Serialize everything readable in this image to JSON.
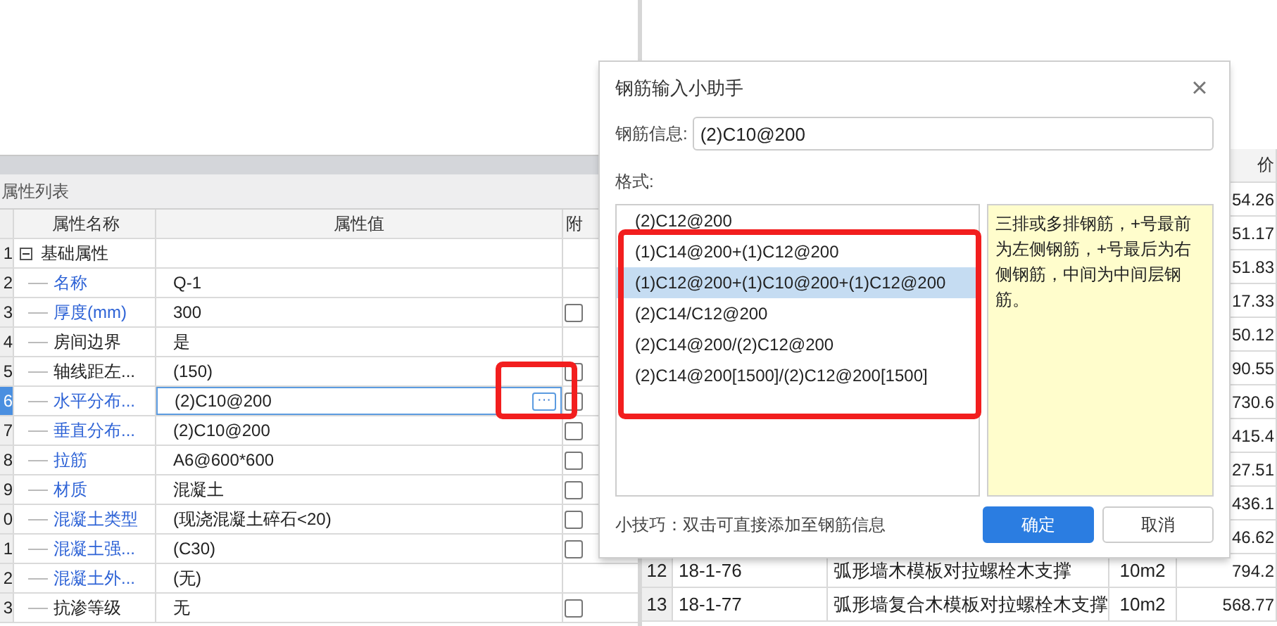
{
  "property_panel": {
    "title": "属性列表",
    "columns": [
      "属性名称",
      "属性值",
      "附"
    ],
    "rows": [
      {
        "number": "1",
        "kind": "group",
        "name": "基础属性",
        "expanded": true,
        "value": "",
        "checkbox": false,
        "selected": false
      },
      {
        "number": "2",
        "kind": "field",
        "name": "名称",
        "value": "Q-1",
        "checkbox": false,
        "linked": true,
        "selected": false
      },
      {
        "number": "3",
        "kind": "field",
        "name": "厚度(mm)",
        "value": "300",
        "checkbox": true,
        "linked": true,
        "selected": false
      },
      {
        "number": "4",
        "kind": "field",
        "name": "房间边界",
        "value": "是",
        "checkbox": false,
        "linked": false,
        "selected": false
      },
      {
        "number": "5",
        "kind": "field",
        "name": "轴线距左...",
        "value": "(150)",
        "checkbox": true,
        "linked": false,
        "selected": false
      },
      {
        "number": "6",
        "kind": "field",
        "name": "水平分布...",
        "value": "(2)C10@200",
        "checkbox": true,
        "linked": true,
        "selected": true,
        "button": "···"
      },
      {
        "number": "7",
        "kind": "field",
        "name": "垂直分布...",
        "value": "(2)C10@200",
        "checkbox": true,
        "linked": true,
        "selected": false
      },
      {
        "number": "8",
        "kind": "field",
        "name": "拉筋",
        "value": "A6@600*600",
        "checkbox": true,
        "linked": true,
        "selected": false
      },
      {
        "number": "9",
        "kind": "field",
        "name": "材质",
        "value": "混凝土",
        "checkbox": true,
        "linked": true,
        "selected": false
      },
      {
        "number": "0",
        "kind": "field",
        "name": "混凝土类型",
        "value": "(现浇混凝土碎石<20)",
        "checkbox": true,
        "linked": true,
        "selected": false
      },
      {
        "number": "1",
        "kind": "field",
        "name": "混凝土强...",
        "value": "(C30)",
        "checkbox": true,
        "linked": true,
        "selected": false
      },
      {
        "number": "2",
        "kind": "field",
        "name": "混凝土外...",
        "value": "(无)",
        "checkbox": false,
        "linked": true,
        "selected": false
      },
      {
        "number": "3",
        "kind": "field",
        "name": "抗渗等级",
        "value": "无",
        "checkbox": true,
        "linked": false,
        "selected": false
      }
    ]
  },
  "quota_table": {
    "price_header": "价",
    "prices": [
      "54.26",
      "51.17",
      "51.83",
      "17.33",
      "50.12",
      "90.55",
      "730.6",
      "415.4",
      "27.51",
      "436.1",
      "46.62"
    ],
    "rows": [
      {
        "number": "12",
        "code": "18-1-76",
        "name": "弧形墙木模板对拉螺栓木支撑",
        "unit": "10m2",
        "price": "794.2"
      },
      {
        "number": "13",
        "code": "18-1-77",
        "name": "弧形墙复合木模板对拉螺栓木支撑",
        "unit": "10m2",
        "price": "568.77"
      }
    ]
  },
  "dialog": {
    "title": "钢筋输入小助手",
    "close": "×",
    "info_label": "钢筋信息:",
    "info_value": "(2)C10@200",
    "format_label": "格式:",
    "formats": [
      {
        "text": "(2)C12@200",
        "selected": false
      },
      {
        "text": "(1)C14@200+(1)C12@200",
        "selected": false
      },
      {
        "text": "(1)C12@200+(1)C10@200+(1)C12@200",
        "selected": true
      },
      {
        "text": "(2)C14/C12@200",
        "selected": false
      },
      {
        "text": "(2)C14@200/(2)C12@200",
        "selected": false
      },
      {
        "text": "(2)C14@200[1500]/(2)C12@200[1500]",
        "selected": false
      }
    ],
    "description": "三排或多排钢筋，+号最前为左侧钢筋，+号最后为右侧钢筋，中间为中间层钢筋。",
    "tip": "小技巧：双击可直接添加至钢筋信息",
    "buttons": [
      {
        "label": "确定",
        "kind": "primary"
      },
      {
        "label": "取消",
        "kind": "secondary"
      }
    ]
  }
}
